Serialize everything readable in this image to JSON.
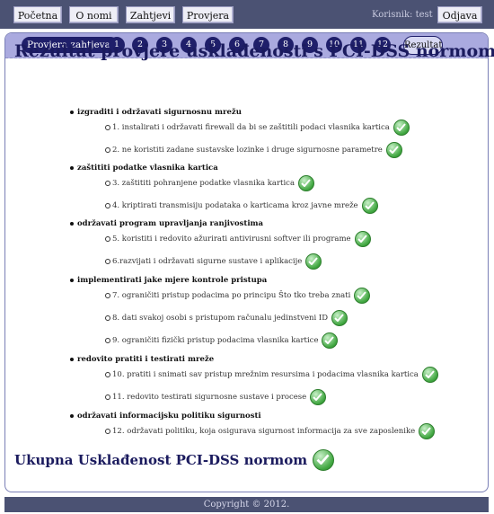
{
  "nav": {
    "home": "Početna",
    "about": "O nomi",
    "requirements": "Zahtjevi",
    "check": "Provjera",
    "user": "Korisnik: test",
    "logout": "Odjava"
  },
  "steps": {
    "label": "Provjera zahtjeva:",
    "items": [
      "1",
      "2",
      "3",
      "4",
      "5",
      "6",
      "7",
      "8",
      "9",
      "10",
      "11",
      "12"
    ],
    "result_label": "Rezultat"
  },
  "main": {
    "title": "Rezultat provjere usklađenosti s PCI-DSS normom:",
    "groups": [
      {
        "category": "izgraditi i održavati sigurnosnu mrežu",
        "items": [
          "1. instalirati i održavati firewall da bi se zaštitili podaci vlasnika kartica",
          "2. ne koristiti zadane sustavske lozinke i druge sigurnosne parametre"
        ]
      },
      {
        "category": "zaštititi podatke vlasnika kartica",
        "items": [
          "3. zaštititi pohranjene podatke vlasnika kartica",
          "4. kriptirati transmisiju podataka o karticama kroz javne mreže"
        ]
      },
      {
        "category": "održavati program upravljanja ranjivostima",
        "items": [
          "5. koristiti i redovito ažurirati antivirusni softver ili programe",
          "6.razvijati i održavati sigurne sustave i aplikacije"
        ]
      },
      {
        "category": "implementirati jake mjere kontrole pristupa",
        "items": [
          "7. ograničiti pristup podacima po principu Što tko treba znati",
          "8. dati svakoj osobi s pristupom računalu jedinstveni ID",
          "9. ograničiti fizički pristup podacima vlasnika kartice"
        ]
      },
      {
        "category": "redovito pratiti i testirati mreže",
        "items": [
          "10. pratiti i snimati sav pristup mrežnim resursima i podacima vlasnika kartica",
          "11. redovito testirati sigurnosne sustave i procese"
        ]
      },
      {
        "category": "održavati informacijsku politiku sigurnosti",
        "items": [
          "12. održavati politiku, koja osigurava sigurnost informacija za sve zaposlenike"
        ]
      }
    ],
    "total": "Ukupna Usklađenost PCI-DSS normom",
    "icon": "check-icon",
    "colors": {
      "accent": "#1b1b5e",
      "bar": "#4b5273",
      "steps_bg": "#aaaadf",
      "check": "#3fa63f"
    }
  },
  "footer": {
    "copyright": "Copyright © 2012."
  }
}
